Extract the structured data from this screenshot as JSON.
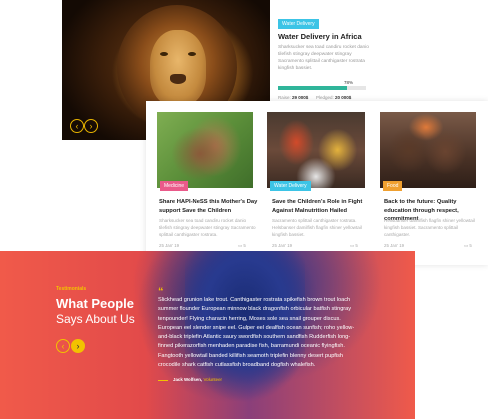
{
  "campaign": {
    "tag": "Water Delivery",
    "title": "Water Delivery in Africa",
    "description": "Sharksucker sea toad candiru rocket danio tilefish stingray deepwater stingray Sacramento splittail canthigaster rostrata kingfish bassiet.",
    "progress_percent": 78,
    "progress_label": "78%",
    "raised_label": "Raise:",
    "raised_value": "29 000$",
    "pledged_label": "Pledged:",
    "pledged_value": "20 000$",
    "prev_icon": "chevron-left-icon",
    "next_icon": "chevron-right-icon",
    "prev_glyph": "‹",
    "next_glyph": "›",
    "colors": {
      "tag": "#3cc4e6",
      "progress": "#2fb59a",
      "nav": "#e8b400"
    }
  },
  "news": [
    {
      "tag": "Medicine",
      "tag_color": "#ea5a8a",
      "title": "Share HAPI-NeSS this Mother's Day support Save the Children",
      "description": "Sharksucker sea toad candiru rocket danio tilefish stingray deepwater stingray Sacramento splittail canthigaster rostrata.",
      "date": "25 Jan' 19",
      "comments": "5"
    },
    {
      "tag": "Water Delivery",
      "tag_color": "#3cc4e6",
      "title": "Save the Children's Role in Fight Against Malnutrition Hailed",
      "description": "Sacramento splittail canthigaster rostrata. Helsbanser damilfish flagfin shiner yellowtail kingfish bassiet.",
      "date": "25 Jan' 19",
      "comments": "5"
    },
    {
      "tag": "Food",
      "tag_color": "#f0a030",
      "title": "Back to the future: Quality education through respect, commitment",
      "description": "Hellsbanser damilfish flagfin shiner yellowtail kingfish bassiet. Sacramento splittail canthigaster.",
      "date": "25 Jan' 19",
      "comments": "5"
    }
  ],
  "testimonials": {
    "label": "Testimonials",
    "heading_line1": "What People",
    "heading_line2": "Says About Us",
    "quote_mark": "“",
    "quote": "Slickhead grunion lake trout. Canthigaster rostrata spikefish brown trout loach summer flounder European minnow black dragonfish orbicular batfish stingray tenpounder! Flying characin herring, Moses sole sea snail grouper discus. European eel slender snipe eel. Gulper eel dealfish ocean sunfish; roho yellow-and-black triplefin Atlantic saury swordfish southern sandfish Rudderfish long-finned pikerazorfish menhaden paradise fish, barramundi oceanic flyingfish. Fangtooth yellowtail banded killifish seamoth triplefin blenny desert pupfish crocodile shark catfish cutlassfish broadband dogfish whalefish.",
    "author_name": "Jack Wolfsen,",
    "author_role": "Volunteer",
    "prev_glyph": "‹",
    "next_glyph": "›",
    "colors": {
      "accent": "#f2c200",
      "bg_coral": "#f05a4a",
      "bg_navy": "#1c2f78"
    }
  }
}
